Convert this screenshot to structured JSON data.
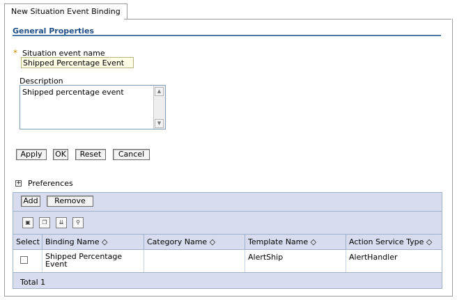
{
  "tab": {
    "label": "New Situation Event Binding"
  },
  "section": {
    "title": "General Properties"
  },
  "form": {
    "required_marker": "*",
    "name_label": "Situation event name",
    "name_value": "Shipped Percentage Event",
    "description_label": "Description",
    "description_value": "Shipped percentage event"
  },
  "buttons": {
    "apply": "Apply",
    "ok": "OK",
    "reset": "Reset",
    "cancel": "Cancel"
  },
  "preferences": {
    "label": "Preferences",
    "expander": "+"
  },
  "table_toolbar": {
    "add": "Add",
    "remove": "Remove"
  },
  "table_icons": [
    "select-all-icon",
    "deselect-all-icon",
    "expand-icon",
    "filter-icon"
  ],
  "table": {
    "columns": [
      "Select",
      "Binding Name",
      "Category Name",
      "Template Name",
      "Action Service Type"
    ],
    "sort_glyph": "◇",
    "rows": [
      {
        "binding_name": "Shipped Percentage Event",
        "category_name": "",
        "template_name": "AlertShip",
        "action_service_type": "AlertHandler"
      }
    ],
    "total": "Total 1"
  },
  "colors": {
    "section_title": "#1f4f86",
    "grid_bg": "#d7ddee",
    "required": "#c58a00"
  }
}
